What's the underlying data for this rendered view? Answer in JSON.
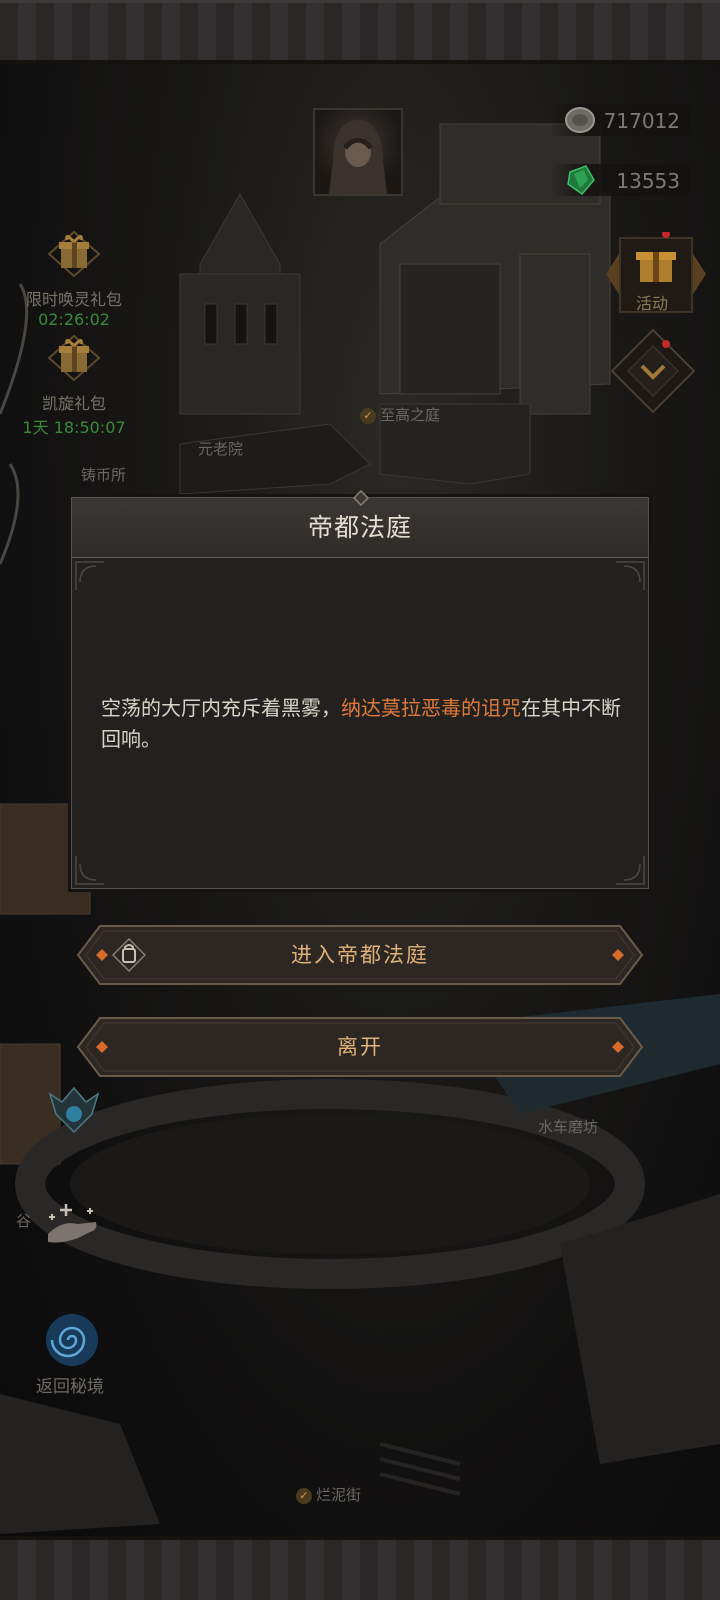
{
  "resources": {
    "silver": {
      "value": "717012",
      "icon": "silver-coin-icon"
    },
    "gem": {
      "value": "13553",
      "icon": "green-gem-icon"
    }
  },
  "gift_packs": [
    {
      "name": "限时唤灵礼包",
      "timer": "02:26:02",
      "icon": "gift-box-icon"
    },
    {
      "name": "凯旋礼包",
      "timer": "1天 18:50:07",
      "icon": "gift-box-icon"
    }
  ],
  "activity": {
    "label": "活动",
    "icon": "gift-icon"
  },
  "map_labels": {
    "supreme_court": "至高之庭",
    "senate": "元老院",
    "mint": "铸币所",
    "watermill": "水车磨坊",
    "valley": "谷",
    "mud_street": "烂泥街"
  },
  "dialog": {
    "title": "帝都法庭",
    "text_before": "空荡的大厅内充斥着黑雾，",
    "text_highlight": "纳达莫拉恶毒的诅咒",
    "text_after": "在其中不断回响。"
  },
  "buttons": {
    "enter": "进入帝都法庭",
    "leave": "离开"
  },
  "return_secret": {
    "label": "返回秘境",
    "icon": "vortex-icon"
  },
  "colors": {
    "highlight": "#e07a3a",
    "button_text": "#e0b27a",
    "timer": "#3a8a3c"
  }
}
